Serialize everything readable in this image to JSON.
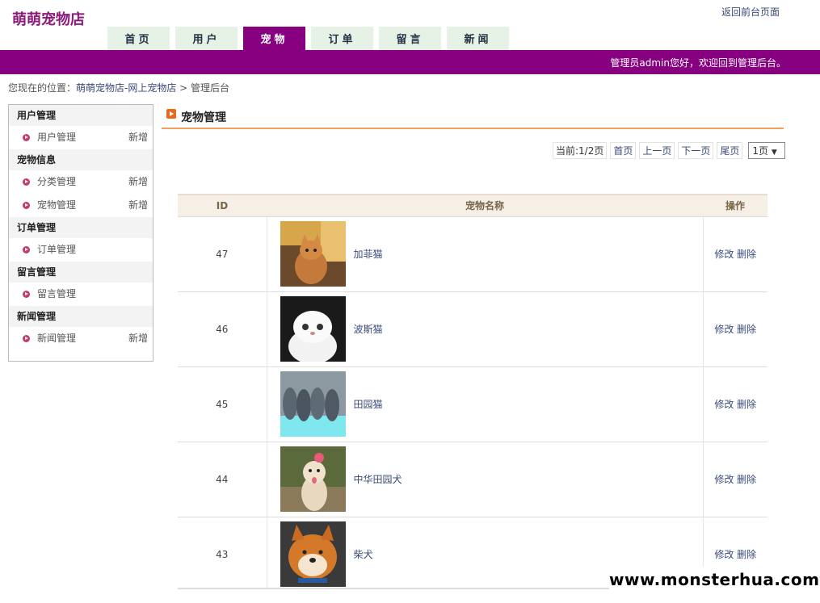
{
  "header": {
    "site_title": "萌萌宠物店",
    "back_link": "返回前台页面"
  },
  "nav": {
    "tabs": [
      {
        "label": "首页"
      },
      {
        "label": "用户"
      },
      {
        "label": "宠物"
      },
      {
        "label": "订单"
      },
      {
        "label": "留言"
      },
      {
        "label": "新闻"
      }
    ],
    "active_index": 2
  },
  "banner": {
    "welcome": "管理员admin您好，欢迎回到管理后台。"
  },
  "breadcrumb": {
    "prefix": "您现在的位置：",
    "link": "萌萌宠物店-网上宠物店",
    "separator": " > ",
    "current": "管理后台"
  },
  "sidebar": {
    "groups": [
      {
        "title": "用户管理",
        "items": [
          {
            "label": "用户管理",
            "add": "新增"
          }
        ]
      },
      {
        "title": "宠物信息",
        "items": [
          {
            "label": "分类管理",
            "add": "新增"
          },
          {
            "label": "宠物管理",
            "add": "新增"
          }
        ]
      },
      {
        "title": "订单管理",
        "items": [
          {
            "label": "订单管理",
            "add": ""
          }
        ]
      },
      {
        "title": "留言管理",
        "items": [
          {
            "label": "留言管理",
            "add": ""
          }
        ]
      },
      {
        "title": "新闻管理",
        "items": [
          {
            "label": "新闻管理",
            "add": "新增"
          }
        ]
      }
    ]
  },
  "main": {
    "section_title": "宠物管理",
    "pager": {
      "current": "当前:1/2页",
      "first": "首页",
      "prev": "上一页",
      "next": "下一页",
      "last": "尾页",
      "select_value": "1页"
    },
    "table": {
      "headers": {
        "id": "ID",
        "name": "宠物名称",
        "op": "操作"
      },
      "rows": [
        {
          "id": "47",
          "name": "加菲猫",
          "edit": "修改",
          "delete": "删除"
        },
        {
          "id": "46",
          "name": "波斯猫",
          "edit": "修改",
          "delete": "删除"
        },
        {
          "id": "45",
          "name": "田园猫",
          "edit": "修改",
          "delete": "删除"
        },
        {
          "id": "44",
          "name": "中华田园犬",
          "edit": "修改",
          "delete": "删除"
        },
        {
          "id": "43",
          "name": "柴犬",
          "edit": "修改",
          "delete": "删除"
        }
      ]
    }
  },
  "watermark": "www.monsterhua.com",
  "colors": {
    "brand": "#870080",
    "nav_tab": "#e5f2e5",
    "accent_line": "#f0a060",
    "link": "#3a4a7a"
  }
}
